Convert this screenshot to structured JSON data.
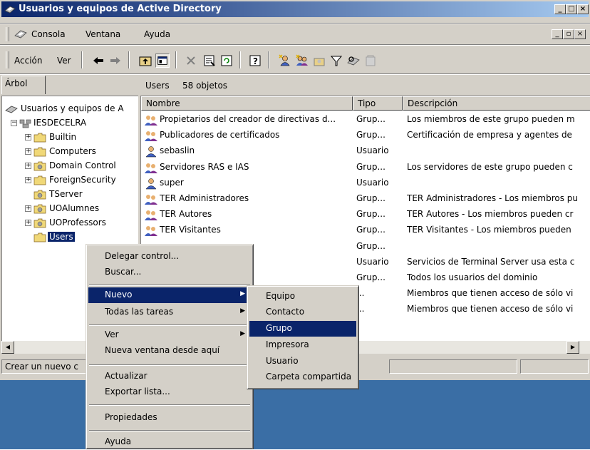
{
  "window": {
    "title": "Usuarios y equipos de Active Directory"
  },
  "menubar": {
    "items": [
      "Consola",
      "Ventana",
      "Ayuda"
    ]
  },
  "toolbar": {
    "action_label": "Acción",
    "view_label": "Ver"
  },
  "tree": {
    "tab_label": "Árbol",
    "root_label": "Usuarios y equipos de A",
    "domain_label": "IESDECELRA",
    "items": [
      "Builtin",
      "Computers",
      "Domain Control",
      "ForeignSecurity",
      "TServer",
      "UOAlumnes",
      "UOProfessors",
      "Users"
    ]
  },
  "pane": {
    "title": "Users",
    "count": "58 objetos"
  },
  "columns": {
    "name": "Nombre",
    "type": "Tipo",
    "description": "Descripción"
  },
  "rows": [
    {
      "name": "Propietarios del creador de directivas d...",
      "type": "Grup...",
      "desc": "Los miembros de este grupo pueden m",
      "icon": "group-icon"
    },
    {
      "name": "Publicadores de certificados",
      "type": "Grup...",
      "desc": "Certificación de empresa y agentes de",
      "icon": "group-icon"
    },
    {
      "name": "sebaslin",
      "type": "Usuario",
      "desc": "",
      "icon": "user-icon"
    },
    {
      "name": "Servidores RAS e IAS",
      "type": "Grup...",
      "desc": "Los servidores de este grupo pueden c",
      "icon": "group-icon"
    },
    {
      "name": "super",
      "type": "Usuario",
      "desc": "",
      "icon": "user-icon"
    },
    {
      "name": "TER Administradores",
      "type": "Grup...",
      "desc": "TER Administradores - Los miembros pu",
      "icon": "group-icon"
    },
    {
      "name": "TER Autores",
      "type": "Grup...",
      "desc": "TER Autores - Los miembros pueden cr",
      "icon": "group-icon"
    },
    {
      "name": "TER Visitantes",
      "type": "Grup...",
      "desc": "TER Visitantes - Los miembros pueden",
      "icon": "group-icon"
    },
    {
      "name": "",
      "type": "Grup...",
      "desc": "",
      "icon": ""
    },
    {
      "name": "",
      "type": "Usuario",
      "desc": "Servicios de Terminal Server usa esta c",
      "icon": ""
    },
    {
      "name": "",
      "type": "Grup...",
      "desc": "Todos los usuarios del dominio",
      "icon": ""
    },
    {
      "name": "",
      "type": "...",
      "desc": "Miembros que tienen acceso de sólo vi",
      "icon": ""
    },
    {
      "name": "",
      "type": "...",
      "desc": "Miembros que tienen acceso de sólo vi",
      "icon": ""
    }
  ],
  "status": {
    "text": "Crear un nuevo c"
  },
  "context_menu": {
    "items": [
      "Delegar control...",
      "Buscar...",
      "Nuevo",
      "Todas las tareas",
      "Ver",
      "Nueva ventana desde aquí",
      "Actualizar",
      "Exportar lista...",
      "Propiedades",
      "Ayuda"
    ]
  },
  "submenu": {
    "items": [
      "Equipo",
      "Contacto",
      "Grupo",
      "Impresora",
      "Usuario",
      "Carpeta compartida"
    ],
    "highlighted": "Grupo"
  },
  "colors": {
    "highlight": "#0a246a",
    "face": "#d4d0c8",
    "desktop": "#3a6ea5"
  }
}
